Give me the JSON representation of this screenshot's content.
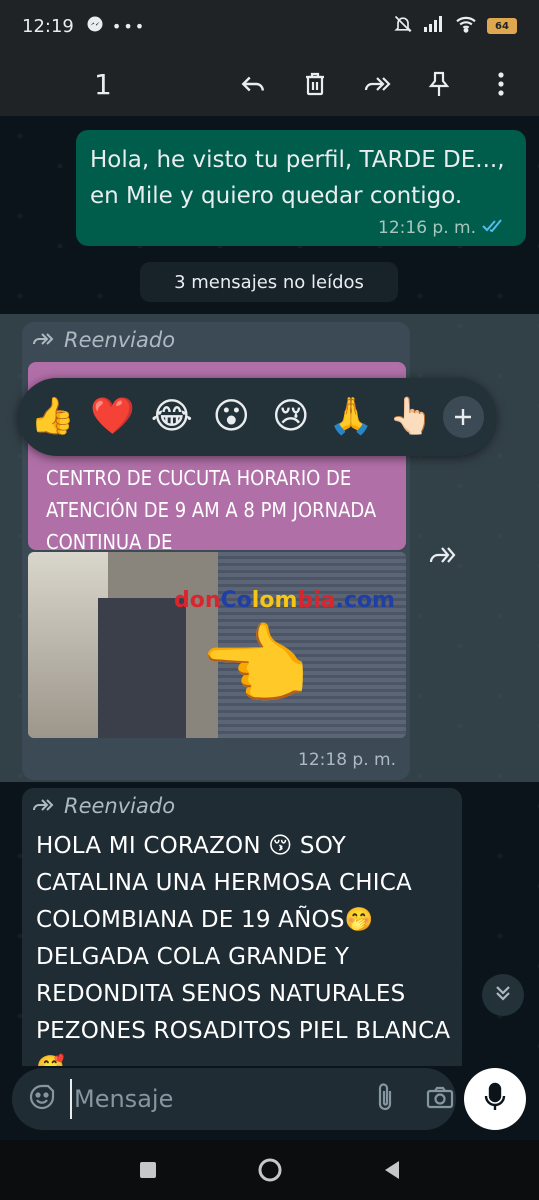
{
  "status_bar": {
    "time": "12:19",
    "battery": "64"
  },
  "app_bar": {
    "selected_count": "1"
  },
  "messages": {
    "outgoing": {
      "text": "Hola, he visto tu perfil, TARDE DE..., en Mile y quiero quedar contigo.",
      "time": "12:16 p. m."
    },
    "unread_banner": "3 mensajes no leídos",
    "forwarded_1": {
      "forwarded_label": "Reenviado",
      "card_text": "CENTRO DE CUCUTA HORARIO DE ATENCIÓN DE 9 AM A 8 PM JORNADA CONTINUA DE",
      "image_brand": "donColombia.com",
      "time": "12:18 p. m."
    },
    "forwarded_2": {
      "forwarded_label": "Reenviado",
      "text": "HOLA MI CORAZON 😚 SOY CATALINA UNA HERMOSA CHICA COLOMBIANA DE 19 AÑOS🤭 DELGADA COLA GRANDE Y REDONDITA SENOS NATURALES PEZONES ROSADITOS PIEL BLANCA🥰"
    }
  },
  "reactions": [
    "👍",
    "❤️",
    "😂",
    "😮",
    "😢",
    "🙏",
    "👆🏻"
  ],
  "composer": {
    "placeholder": "Mensaje"
  },
  "colors": {
    "outgoing_bubble": "#005c4b",
    "incoming_bubble": "#1f2c34",
    "accent": "#25d366",
    "card_pink": "#b16fa8"
  }
}
